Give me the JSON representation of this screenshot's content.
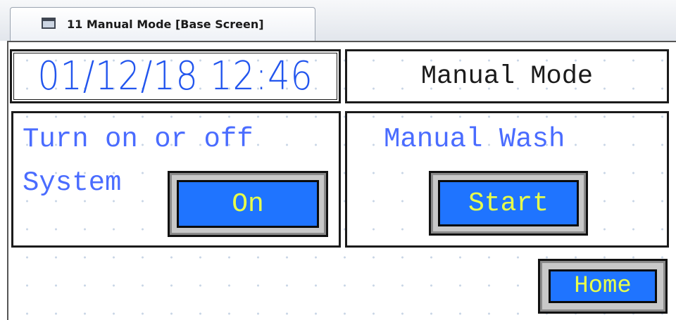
{
  "tab": {
    "icon": "window-icon",
    "label": "11 Manual Mode [Base Screen]"
  },
  "hmi": {
    "datetime": "01/12/18 12:46",
    "title": "Manual Mode",
    "system_panel": {
      "line1": "Turn on or off",
      "line2": "System",
      "button_label": "On"
    },
    "wash_panel": {
      "label": "Manual Wash",
      "button_label": "Start"
    },
    "home_button_label": "Home"
  },
  "colors": {
    "button_face": "#1f74ff",
    "button_text": "#e8ff4a",
    "label_text": "#4a6cff",
    "datetime_text": "#2255ee"
  }
}
